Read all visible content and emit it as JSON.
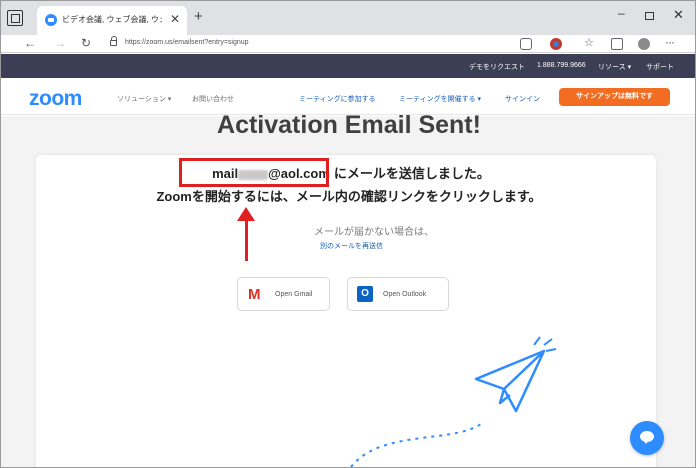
{
  "browser": {
    "tab_title": "ビデオ会議, ウェブ会議, ウェビナー, 画",
    "tab_close": "✕",
    "new_tab": "+",
    "url": "https://zoom.us/emailsent?entry=signup",
    "window_min": "–",
    "window_close": "✕"
  },
  "topbar": {
    "demo_request": "デモをリクエスト",
    "phone": "1.888.799.9666",
    "resources": "リソース ▾",
    "support": "サポート"
  },
  "nav": {
    "logo": "zoom",
    "solutions": "ソリューション ▾",
    "contact": "お問い合わせ",
    "join": "ミーティングに参加する",
    "host": "ミーティングを開催する ▾",
    "signin": "サインイン",
    "signup": "サインアップは無料です"
  },
  "main": {
    "headline": "Activation Email Sent!",
    "email_prefix": "mail",
    "email_domain": "@aol.com",
    "sent_msg": "にメールを送信しました。",
    "instruction": "Zoomを開始するには、メール内の確認リンクをクリックします。",
    "not_arrive": "メールが届かない場合は、",
    "resend_link": "別のメールを再送信",
    "gmail_label": "Open Gmail",
    "outlook_label": "Open Outlook"
  },
  "colors": {
    "zoom_blue": "#2d8cff",
    "signup_orange": "#f26d21",
    "highlight_red": "#e02020",
    "top_strip": "#3b3e55"
  }
}
